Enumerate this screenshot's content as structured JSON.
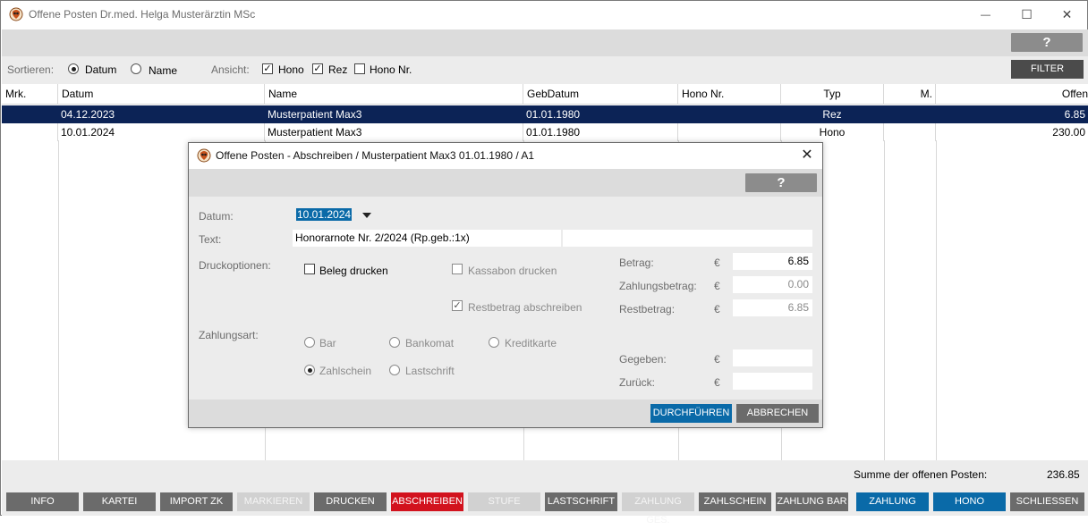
{
  "window": {
    "title": "Offene Posten Dr.med. Helga Musterärztin MSc",
    "min_glyph": "—",
    "max_glyph": "☐",
    "close_glyph": "✕"
  },
  "help": {
    "label": "?"
  },
  "sortbar": {
    "sort_label": "Sortieren:",
    "sort_options": [
      "Datum",
      "Name"
    ],
    "sort_selected": "Datum",
    "view_label": "Ansicht:",
    "view_options": [
      {
        "label": "Hono",
        "checked": true
      },
      {
        "label": "Rez",
        "checked": true
      },
      {
        "label": "Hono Nr.",
        "checked": false
      }
    ],
    "filter_label": "FILTER"
  },
  "table": {
    "columns": [
      "Mrk.",
      "Datum",
      "Name",
      "GebDatum",
      "Hono Nr.",
      "Typ",
      "M.",
      "Offen"
    ],
    "rows": [
      {
        "mrk": "",
        "datum": "04.12.2023",
        "name": "Musterpatient Max3",
        "gebdatum": "01.01.1980",
        "hono_nr": "",
        "typ": "Rez",
        "m": "",
        "offen": "6.85",
        "selected": true
      },
      {
        "mrk": "",
        "datum": "10.01.2024",
        "name": "Musterpatient Max3",
        "gebdatum": "01.01.1980",
        "hono_nr": "",
        "typ": "Hono",
        "m": "",
        "offen": "230.00",
        "selected": false
      }
    ]
  },
  "footer": {
    "sum_label": "Summe der offenen Posten:",
    "sum_value": "236.85",
    "buttons": [
      {
        "label": "INFO",
        "state": "grey"
      },
      {
        "label": "KARTEI",
        "state": "grey"
      },
      {
        "label": "IMPORT ZK",
        "state": "grey"
      },
      {
        "label": "MARKIEREN",
        "state": "disabled"
      },
      {
        "label": "DRUCKEN",
        "state": "grey"
      },
      {
        "label": "ABSCHREIBEN",
        "state": "red"
      },
      {
        "label": "STUFE",
        "state": "disabled"
      },
      {
        "label": "LASTSCHRIFT",
        "state": "grey"
      },
      {
        "label": "ZAHLUNG GES.",
        "state": "disabled"
      },
      {
        "label": "ZAHLSCHEIN",
        "state": "grey"
      },
      {
        "label": "ZAHLUNG BAR",
        "state": "grey"
      },
      {
        "label": "ZAHLUNG",
        "state": "blue"
      },
      {
        "label": "HONO",
        "state": "blue"
      },
      {
        "label": "SCHLIESSEN",
        "state": "grey"
      }
    ]
  },
  "dialog": {
    "title": "Offene Posten - Abschreiben / Musterpatient Max3 01.01.1980 / A1",
    "close_glyph": "✕",
    "help_label": "?",
    "datum_label": "Datum:",
    "datum_value": "10.01.2024",
    "text_label": "Text:",
    "text_value": "Honorarnote Nr. 2/2024 (Rp.geb.:1x)",
    "text_value2": "",
    "druck_label": "Druckoptionen:",
    "beleg_label": "Beleg drucken",
    "beleg_checked": false,
    "kassabon_label": "Kassabon drucken",
    "kassabon_checked": false,
    "rest_label": "Restbetrag abschreiben",
    "rest_checked": true,
    "currency": "€",
    "betrag_label": "Betrag:",
    "betrag_value": "6.85",
    "zahlungsbetrag_label": "Zahlungsbetrag:",
    "zahlungsbetrag_value": "0.00",
    "restbetrag_label": "Restbetrag:",
    "restbetrag_value": "6.85",
    "zahlungsart_label": "Zahlungsart:",
    "payment_options": [
      "Bar",
      "Bankomat",
      "Kreditkarte",
      "Zahlschein",
      "Lastschrift"
    ],
    "payment_selected": "Zahlschein",
    "gegeben_label": "Gegeben:",
    "gegeben_value": "",
    "zurueck_label": "Zurück:",
    "zurueck_value": "",
    "ok_label": "DURCHFÜHREN",
    "cancel_label": "ABBRECHEN"
  }
}
